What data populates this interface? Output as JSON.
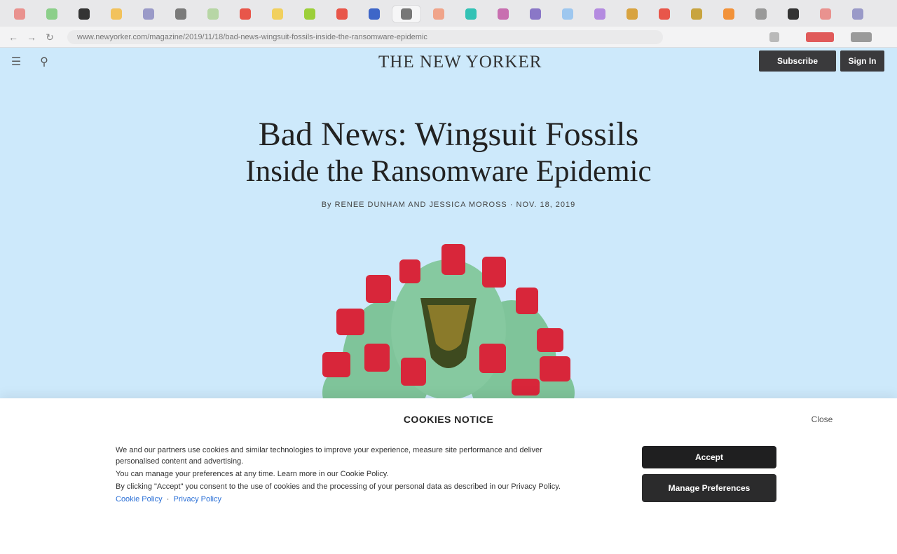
{
  "browser": {
    "tab_colors": [
      "#e9928f",
      "#8ccf8a",
      "#333333",
      "#f2c25c",
      "#9a9ac8",
      "#7a7a7a",
      "#b7d6a5",
      "#e8564a",
      "#f1d05e",
      "#9ccf3a",
      "#e8564a",
      "#3e66c8",
      "#777777",
      "#f0a48a",
      "#33c2b5",
      "#c86fb0",
      "#8a77c7",
      "#9ec7ef",
      "#b48be0",
      "#d8a340",
      "#e8564a",
      "#c8a440",
      "#f2923a",
      "#999999",
      "#333333",
      "#e9928f",
      "#9a9ac8"
    ],
    "url": "www.newyorker.com/magazine/2019/11/18/bad-news-wingsuit-fossils-inside-the-ransomware-epidemic",
    "ext_colors": [
      "#b9b9b9",
      "#e05a5a",
      "#9a9a9a"
    ]
  },
  "site": {
    "masthead": "THE NEW YORKER",
    "subscribe_label": "Subscribe",
    "login_label": "Sign In",
    "menu_icon": "menu-icon",
    "search_icon": "search-icon"
  },
  "article": {
    "headline_line1": "Bad News: Wingsuit Fossils",
    "headline_line2": "Inside the Ransomware Epidemic",
    "byline": "By RENEE DUNHAM AND JESSICA MOROSS · NOV. 18, 2019"
  },
  "cookie_banner": {
    "title": "COOKIES NOTICE",
    "close_label": "Close",
    "paragraphs": [
      "We and our partners use cookies and similar technologies to improve your experience, measure site performance and deliver personalised content and advertising.",
      "You can manage your preferences at any time. Learn more in our Cookie Policy.",
      "By clicking \"Accept\" you consent to the use of cookies and the processing of your personal data as described in our Privacy Policy."
    ],
    "links": [
      "Cookie Policy",
      "Privacy Policy"
    ],
    "accept_label": "Accept",
    "manage_label": "Manage Preferences"
  },
  "colors": {
    "hero_bg": "#cde9fb",
    "button_dark": "#1f1f20",
    "cactus": "#7fc49a",
    "flower": "#d8263a"
  }
}
